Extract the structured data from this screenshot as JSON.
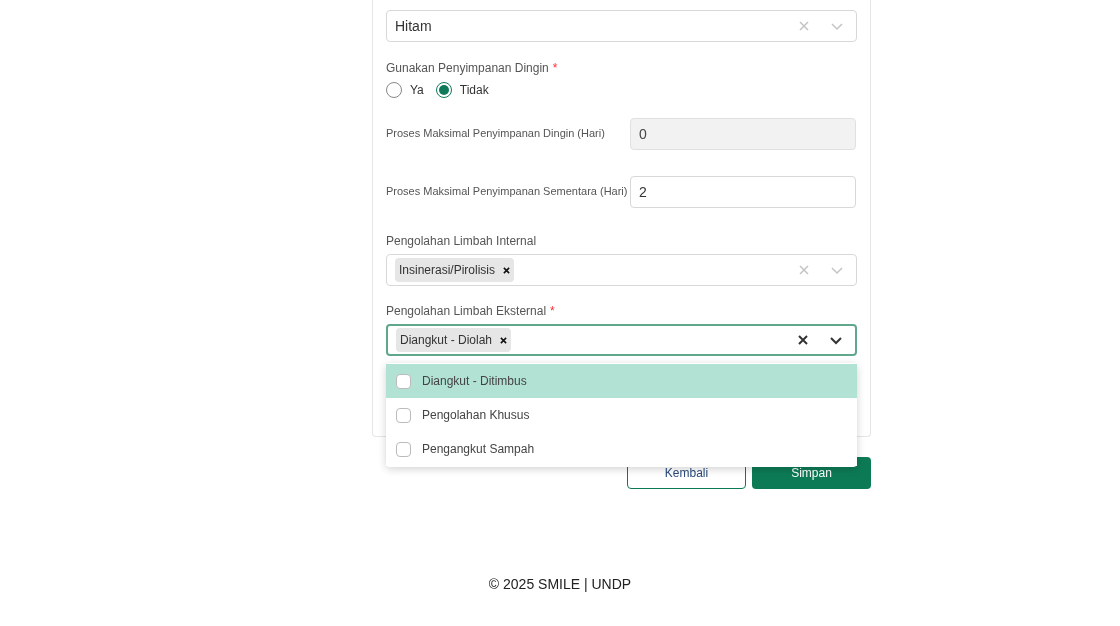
{
  "bag_color_select": {
    "value": "Hitam"
  },
  "cold_storage": {
    "label": "Gunakan Penyimpanan Dingin",
    "required": true,
    "options": [
      {
        "label": "Ya",
        "selected": false
      },
      {
        "label": "Tidak",
        "selected": true
      }
    ]
  },
  "number_fields": [
    {
      "label": "Proses Maksimal Penyimpanan Dingin (Hari)",
      "value": "0",
      "disabled": true
    },
    {
      "label": "Proses Maksimal Penyimpanan Sementara (Hari)",
      "value": "2",
      "disabled": false
    }
  ],
  "internal_processing": {
    "label": "Pengolahan Limbah Internal",
    "required": false,
    "focused": false,
    "tags": [
      "Insinerasi/Pirolisis"
    ]
  },
  "external_processing": {
    "label": "Pengolahan Limbah Eksternal",
    "required": true,
    "focused": true,
    "tags": [
      "Diangkut - Diolah"
    ]
  },
  "dropdown_options": [
    {
      "label": "Diangkut - Ditimbus",
      "highlighted": true,
      "checked": false
    },
    {
      "label": "Pengolahan Khusus",
      "highlighted": false,
      "checked": false
    },
    {
      "label": "Pengangkut Sampah",
      "highlighted": false,
      "checked": false
    }
  ],
  "buttons": [
    {
      "label": "Kembali",
      "kind": "secondary"
    },
    {
      "label": "Simpan",
      "kind": "primary"
    }
  ],
  "footer": "© 2025 SMILE | UNDP",
  "required_mark": "*"
}
